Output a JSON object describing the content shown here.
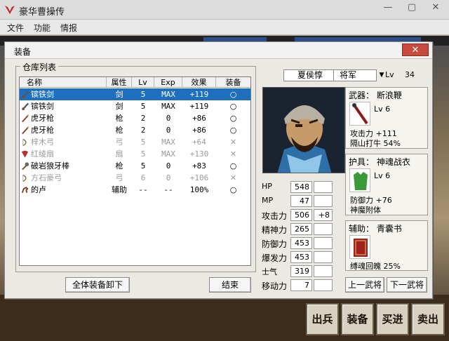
{
  "app": {
    "title": "豪华曹操传"
  },
  "window_controls": [
    "—",
    "▢",
    "✕"
  ],
  "menu": [
    "文件",
    "功能",
    "情报"
  ],
  "dialog": {
    "title": "装备",
    "close_label": "✕",
    "inventory_label": "仓库列表",
    "columns": [
      "名称",
      "属性",
      "Lv",
      "Exp",
      "效果",
      "装备"
    ],
    "items": [
      {
        "icon": "sword-icon",
        "name": "镔铁剑",
        "type": "剑",
        "lv": "5",
        "exp": "MAX",
        "effect": "+119",
        "equip": "○",
        "selected": true,
        "dim": false
      },
      {
        "icon": "sword-icon",
        "name": "镔铁剑",
        "type": "剑",
        "lv": "5",
        "exp": "MAX",
        "effect": "+119",
        "equip": "○",
        "selected": false,
        "dim": false
      },
      {
        "icon": "spear-icon",
        "name": "虎牙枪",
        "type": "枪",
        "lv": "2",
        "exp": "0",
        "effect": "+86",
        "equip": "○",
        "selected": false,
        "dim": false
      },
      {
        "icon": "spear-icon",
        "name": "虎牙枪",
        "type": "枪",
        "lv": "2",
        "exp": "0",
        "effect": "+86",
        "equip": "○",
        "selected": false,
        "dim": false
      },
      {
        "icon": "bow-icon",
        "name": "梓木弓",
        "type": "弓",
        "lv": "5",
        "exp": "MAX",
        "effect": "+64",
        "equip": "✕",
        "selected": false,
        "dim": true
      },
      {
        "icon": "fan-icon",
        "name": "红绫扇",
        "type": "扇",
        "lv": "5",
        "exp": "MAX",
        "effect": "+130",
        "equip": "✕",
        "selected": false,
        "dim": true
      },
      {
        "icon": "mace-icon",
        "name": "破岩狼牙棒",
        "type": "枪",
        "lv": "5",
        "exp": "0",
        "effect": "+83",
        "equip": "○",
        "selected": false,
        "dim": false
      },
      {
        "icon": "bow-icon",
        "name": "方石豪弓",
        "type": "弓",
        "lv": "6",
        "exp": "0",
        "effect": "+106",
        "equip": "✕",
        "selected": false,
        "dim": true
      },
      {
        "icon": "horse-icon",
        "name": "的卢",
        "type": "辅助",
        "lv": "--",
        "exp": "--",
        "effect": "100%",
        "equip": "○",
        "selected": false,
        "dim": false
      }
    ],
    "unequip_all_label": "全体装备卸下",
    "close_button_label": "结束",
    "hero": {
      "name": "夏侯惇",
      "rank": "将军",
      "rank_arrow": "▼",
      "lv_label": "Lv",
      "lv": "34",
      "stats": [
        {
          "label": "HP",
          "value": "548",
          "bonus": ""
        },
        {
          "label": "MP",
          "value": "47",
          "bonus": ""
        },
        {
          "label": "攻击力",
          "value": "506",
          "bonus": "+8"
        },
        {
          "label": "精神力",
          "value": "265",
          "bonus": ""
        },
        {
          "label": "防御力",
          "value": "453",
          "bonus": ""
        },
        {
          "label": "爆发力",
          "value": "453",
          "bonus": ""
        },
        {
          "label": "士气",
          "value": "319",
          "bonus": ""
        },
        {
          "label": "移动力",
          "value": "7",
          "bonus": ""
        }
      ]
    },
    "weapon": {
      "title": "武器： 断浪鞭",
      "lv": "Lv 6",
      "line1": "攻击力 +111",
      "line2": "隔山打牛 54%"
    },
    "armor": {
      "title": "护具： 神魂战衣",
      "lv": "Lv 6",
      "line1": "防御力 +76",
      "line2": "神魔附体"
    },
    "aux": {
      "title": "辅助： 青囊书",
      "line1": "缚魂回魄 25%"
    },
    "prev_label": "上一武将",
    "next_label": "下一武将"
  },
  "commands": [
    "出兵",
    "装备",
    "买进",
    "卖出"
  ]
}
